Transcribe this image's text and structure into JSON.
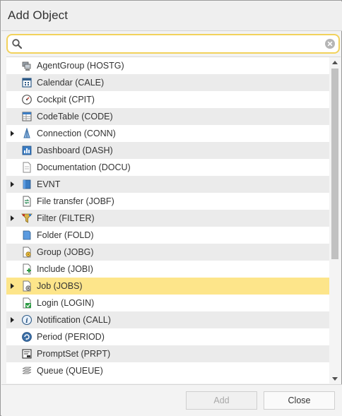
{
  "dialog": {
    "title": "Add Object"
  },
  "search": {
    "placeholder": "",
    "value": ""
  },
  "items": [
    {
      "label": "AgentGroup (HOSTG)",
      "icon": "agent-group-icon",
      "expandable": false
    },
    {
      "label": "Calendar (CALE)",
      "icon": "calendar-icon",
      "expandable": false
    },
    {
      "label": "Cockpit (CPIT)",
      "icon": "cockpit-gauge-icon",
      "expandable": false
    },
    {
      "label": "CodeTable (CODE)",
      "icon": "code-table-icon",
      "expandable": false
    },
    {
      "label": "Connection (CONN)",
      "icon": "connection-icon",
      "expandable": true
    },
    {
      "label": "Dashboard (DASH)",
      "icon": "dashboard-icon",
      "expandable": false
    },
    {
      "label": "Documentation (DOCU)",
      "icon": "document-icon",
      "expandable": false
    },
    {
      "label": "EVNT",
      "icon": "event-icon",
      "expandable": true
    },
    {
      "label": "File transfer (JOBF)",
      "icon": "file-transfer-icon",
      "expandable": false
    },
    {
      "label": "Filter (FILTER)",
      "icon": "filter-icon",
      "expandable": true
    },
    {
      "label": "Folder (FOLD)",
      "icon": "folder-icon",
      "expandable": false
    },
    {
      "label": "Group (JOBG)",
      "icon": "job-group-icon",
      "expandable": false
    },
    {
      "label": "Include (JOBI)",
      "icon": "include-icon",
      "expandable": false
    },
    {
      "label": "Job (JOBS)",
      "icon": "job-icon",
      "expandable": true,
      "selected": true
    },
    {
      "label": "Login (LOGIN)",
      "icon": "login-icon",
      "expandable": false
    },
    {
      "label": "Notification (CALL)",
      "icon": "info-icon",
      "expandable": true
    },
    {
      "label": "Period (PERIOD)",
      "icon": "period-icon",
      "expandable": false
    },
    {
      "label": "PromptSet (PRPT)",
      "icon": "prompt-set-icon",
      "expandable": false
    },
    {
      "label": "Queue (QUEUE)",
      "icon": "queue-icon",
      "expandable": false
    }
  ],
  "footer": {
    "add_label": "Add",
    "close_label": "Close"
  },
  "colors": {
    "selected_row": "#fde58a",
    "alt_row": "#ebebeb",
    "search_focus": "#f2d25c"
  }
}
